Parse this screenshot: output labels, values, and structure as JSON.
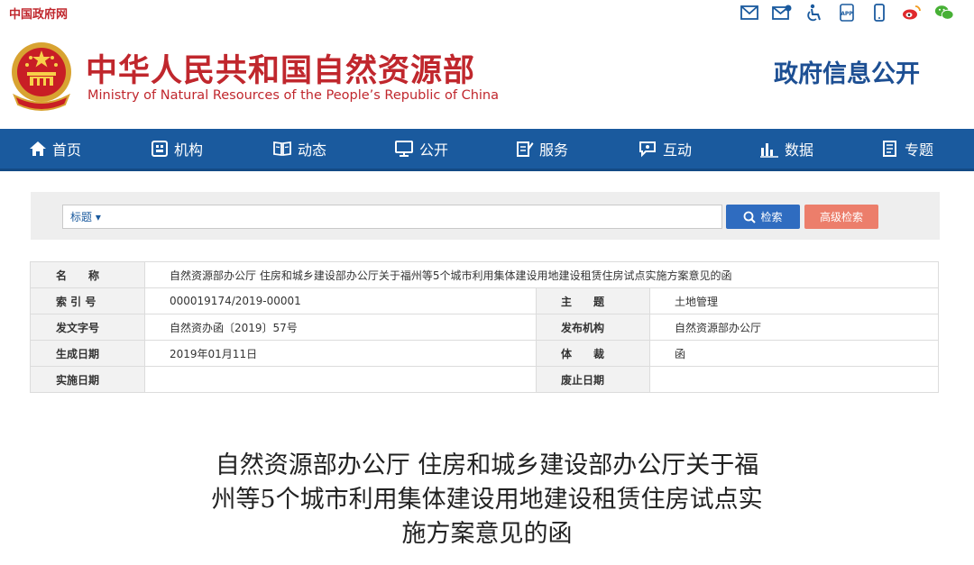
{
  "topbar": {
    "gov_link": "中国政府网",
    "icons": [
      "email-icon",
      "mailbox-icon",
      "accessibility-icon",
      "app-icon",
      "mobile-icon",
      "weibo-icon",
      "wechat-icon"
    ]
  },
  "header": {
    "title_cn": "中华人民共和国自然资源部",
    "title_en": "Ministry of Natural Resources of the People’s Republic of China",
    "section": "政府信息公开"
  },
  "nav": {
    "items": [
      {
        "label": "首页",
        "icon": "home-icon"
      },
      {
        "label": "机构",
        "icon": "org-icon"
      },
      {
        "label": "动态",
        "icon": "book-icon"
      },
      {
        "label": "公开",
        "icon": "monitor-icon"
      },
      {
        "label": "服务",
        "icon": "edit-icon"
      },
      {
        "label": "互动",
        "icon": "chat-icon"
      },
      {
        "label": "数据",
        "icon": "chart-icon"
      },
      {
        "label": "专题",
        "icon": "document-icon"
      }
    ]
  },
  "search": {
    "field": "标题 ▾",
    "value": "",
    "search_label": "检索",
    "advanced_label": "高级检索"
  },
  "info": {
    "name_label": "名　　称",
    "name_value": "自然资源部办公厅 住房和城乡建设部办公厅关于福州等5个城市利用集体建设用地建设租赁住房试点实施方案意见的函",
    "index_label": "索 引 号",
    "index_value": "000019174/2019-00001",
    "subject_label": "主　　题",
    "subject_value": "土地管理",
    "docno_label": "发文字号",
    "docno_value": "自然资办函〔2019〕57号",
    "issuer_label": "发布机构",
    "issuer_value": "自然资源部办公厅",
    "created_label": "生成日期",
    "created_value": "2019年01月11日",
    "genre_label": "体　　裁",
    "genre_value": "函",
    "effective_label": "实施日期",
    "effective_value": "",
    "expire_label": "废止日期",
    "expire_value": ""
  },
  "document": {
    "title_line1": "自然资源部办公厅 住房和城乡建设部办公厅关于福",
    "title_line2": "州等5个城市利用集体建设用地建设租赁住房试点实",
    "title_line3": "施方案意见的函"
  },
  "colors": {
    "brand_red": "#c0272d",
    "nav_blue": "#1a5a9e",
    "section_blue": "#1d4f93",
    "search_btn": "#2f6cc0",
    "advanced_btn": "#ec7e6b"
  }
}
